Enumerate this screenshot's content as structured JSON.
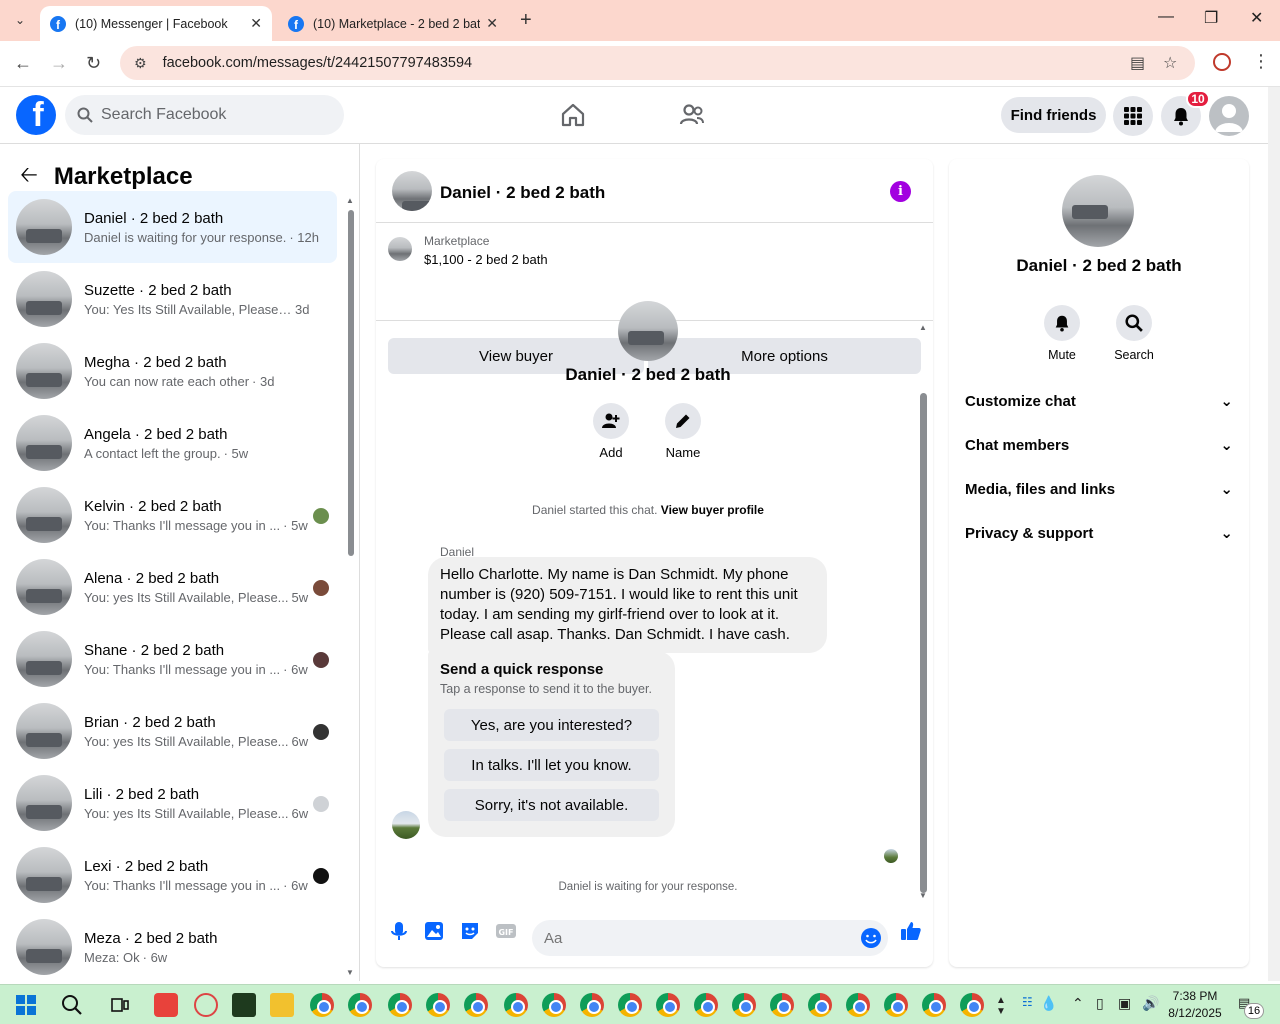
{
  "browser": {
    "tabs": [
      {
        "title": "(10) Messenger | Facebook",
        "active": true
      },
      {
        "title": "(10) Marketplace - 2 bed 2 bath",
        "active": false
      }
    ],
    "url": "facebook.com/messages/t/24421507797483594"
  },
  "header": {
    "search_placeholder": "Search Facebook",
    "find_friends": "Find friends",
    "notification_count": "10"
  },
  "sidebar": {
    "title": "Marketplace",
    "conversations": [
      {
        "name": "Daniel · 2 bed 2 bath",
        "preview": "Daniel is waiting for your response.",
        "time": "· 12h",
        "active": true
      },
      {
        "name": "Suzette · 2 bed 2 bath",
        "preview": "You: Yes Its Still Available, Please Se...",
        "time": "3d"
      },
      {
        "name": "Megha · 2 bed 2 bath",
        "preview": "You can now rate each other",
        "time": "· 3d"
      },
      {
        "name": "Angela · 2 bed 2 bath",
        "preview": "A contact left the group.",
        "time": "· 5w"
      },
      {
        "name": "Kelvin · 2 bed 2 bath",
        "preview": "You: Thanks I'll message you in ...",
        "time": "· 5w",
        "mini": "#6b8f4e"
      },
      {
        "name": "Alena · 2 bed 2 bath",
        "preview": "You: yes Its Still Available, Please...",
        "time": "5w",
        "mini": "#7a4b3a"
      },
      {
        "name": "Shane · 2 bed 2 bath",
        "preview": "You: Thanks I'll message you in ...",
        "time": "· 6w",
        "mini": "#5a3a3a"
      },
      {
        "name": "Brian · 2 bed 2 bath",
        "preview": "You: yes Its Still Available, Please...",
        "time": "6w",
        "mini": "#333333"
      },
      {
        "name": "Lili · 2 bed 2 bath",
        "preview": "You: yes Its Still Available, Please...",
        "time": "6w",
        "mini": "#cfd2d6"
      },
      {
        "name": "Lexi · 2 bed 2 bath",
        "preview": "You: Thanks I'll message you in ...",
        "time": "· 6w",
        "mini": "#111111"
      },
      {
        "name": "Meza · 2 bed 2 bath",
        "preview": "Meza: Ok",
        "time": "· 6w"
      }
    ]
  },
  "chat": {
    "title": "Daniel · 2 bed 2 bath",
    "listing_label": "Marketplace",
    "listing_price": "$1,100 - 2 bed 2 bath",
    "view_buyer": "View buyer",
    "more_options": "More options",
    "profile_name": "Daniel · 2 bed 2 bath",
    "add_label": "Add",
    "name_label": "Name",
    "started_text": "Daniel started this chat.",
    "view_profile": "View buyer profile",
    "sender": "Daniel",
    "message": "Hello Charlotte. My name is Dan Schmidt. My phone number is (920) 509-7151. I would like to rent this unit today. I am sending my girlf-friend over to look at it. Please call asap. Thanks. Dan Schmidt. I have cash.",
    "quick_title": "Send a quick response",
    "quick_sub": "Tap a response to send it to the buyer.",
    "quick_options": [
      "Yes, are you interested?",
      "In talks. I'll let you know.",
      "Sorry, it's not available."
    ],
    "waiting": "Daniel is waiting for your response.",
    "composer_placeholder": "Aa"
  },
  "details": {
    "name": "Daniel · 2 bed 2 bath",
    "mute": "Mute",
    "search": "Search",
    "sections": [
      "Customize chat",
      "Chat members",
      "Media, files and links",
      "Privacy & support"
    ]
  },
  "taskbar": {
    "time": "7:38 PM",
    "date": "8/12/2025",
    "notif": "16"
  }
}
